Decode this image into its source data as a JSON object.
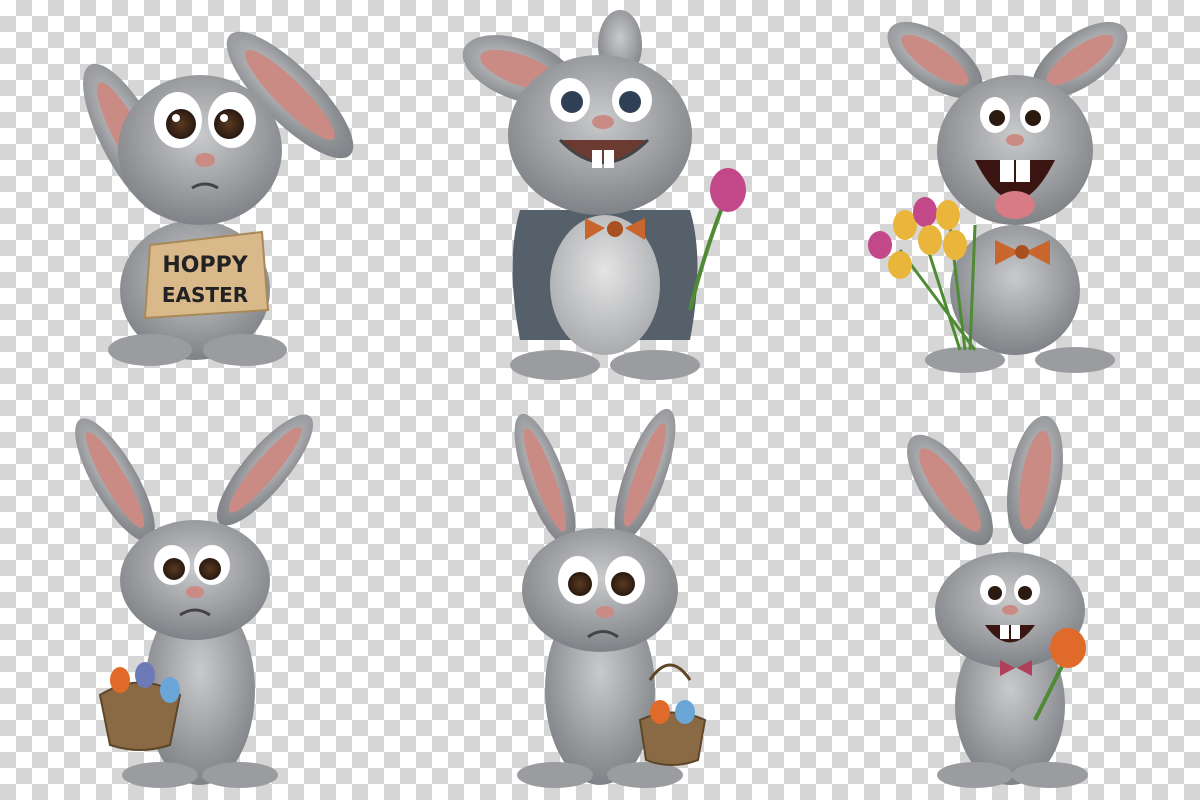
{
  "background": {
    "pattern": "checkerboard",
    "colors": [
      "#ffffff",
      "#d6d6d6"
    ]
  },
  "bunnies": [
    {
      "pose": "worried",
      "prop": "sign",
      "sign_lines": [
        "HOPPY",
        "EASTER"
      ]
    },
    {
      "pose": "smiling",
      "prop": "tulip",
      "outfit": "jacket-and-bowtie"
    },
    {
      "pose": "laughing",
      "prop": "tulip-bouquet",
      "outfit": "bowtie"
    },
    {
      "pose": "sad",
      "prop": "egg-basket"
    },
    {
      "pose": "frowning",
      "prop": "egg-basket"
    },
    {
      "pose": "grinning",
      "prop": "orange-tulip",
      "outfit": "bowtie"
    }
  ],
  "colors": {
    "fur": "#8f9296",
    "fur_light": "#c9cacc",
    "inner_ear": "#c98b84",
    "bowtie": "#c9662e",
    "jacket": "#55606b",
    "sign": "#d9b98a",
    "basket": "#8a6a45",
    "tulip_pink": "#c2488a",
    "tulip_yellow": "#e9b53a",
    "tulip_orange": "#e06a2a"
  }
}
